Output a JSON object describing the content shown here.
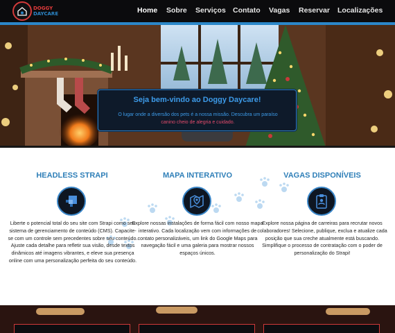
{
  "brand": {
    "line1": "DOGGY",
    "line2": "DAYCARE",
    "logo_icon": "dog-house-icon",
    "colors": {
      "red": "#e23b3b",
      "blue": "#2b87c9"
    }
  },
  "nav": {
    "items": [
      {
        "label": "Home",
        "active": true
      },
      {
        "label": "Sobre"
      },
      {
        "label": "Serviços"
      },
      {
        "label": "Contato"
      },
      {
        "label": "Vagas"
      },
      {
        "label": "Reservar"
      },
      {
        "label": "Localizações"
      }
    ]
  },
  "hero": {
    "title": "Seja bem-vindo ao Doggy Daycare!",
    "subtitle_part1": "O lugar onde a diversão dos pets é a nossa missão. Descubra um paraíso",
    "subtitle_part2": "canino cheio de alegria e cuidado.",
    "image": "christmas-living-room-scene"
  },
  "features": [
    {
      "title": "HEADLESS STRAPI",
      "icon": "strapi-logo-icon",
      "text": "Liberte o potencial total do seu site com Strapi como seu sistema de gerenciamento de conteúdo (CMS). Capacite-se com um controle sem precedentes sobre seu conteúdo. Ajuste cada detalhe para refletir sua visão, desde textos dinâmicos até imagens vibrantes, e eleve sua presença online com uma personalização perfeita do seu conteúdo."
    },
    {
      "title": "MAPA INTERATIVO",
      "icon": "map-pin-icon",
      "text": "Explore nossas instalações de forma fácil com nosso mapa interativo. Cada localização vem com informações de contato personalizáveis, um link do Google Maps para navegação fácil e uma galeria para mostrar nossos espaços únicos."
    },
    {
      "title": "VAGAS DISPONÍVEIS",
      "icon": "job-clipboard-icon",
      "text": "Explore nossa página de carreiras para recrutar novos colaboradores! Selecione, publique, exclua e atualize cada posição que sua creche atualmente está buscando. Simplifique o processo de contratação com o poder de personalização do Strapi!"
    }
  ],
  "colors": {
    "accent_blue": "#2f7fb8",
    "navbar_bg": "#0b0b0d",
    "paw_color": "#bcd9f1"
  }
}
